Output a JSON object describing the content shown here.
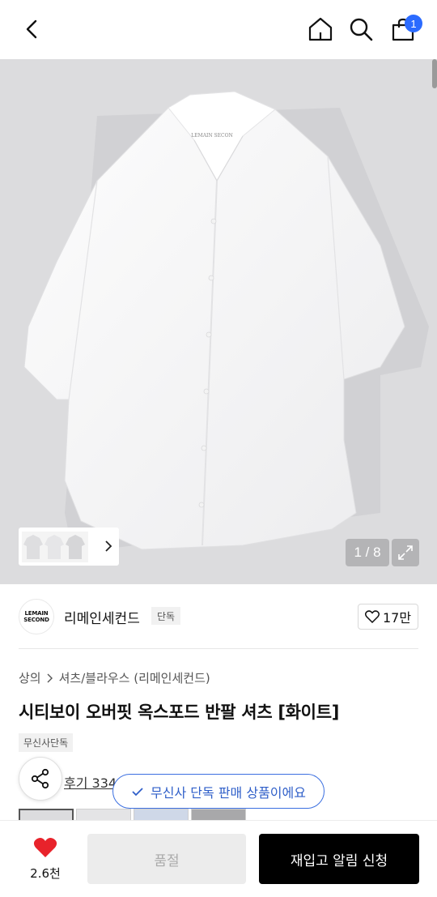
{
  "header": {
    "back_icon": "chevron-left-icon",
    "home_icon": "home-icon",
    "search_icon": "search-icon",
    "bag_icon": "shopping-bag-icon",
    "cart_count": "1",
    "badge_color": "#2b6bff"
  },
  "gallery": {
    "counter": "1 / 8",
    "expand_icon": "expand-icon",
    "product_logo": "LEMAIN SECON"
  },
  "brand": {
    "logo_line1": "LEMAIN",
    "logo_line2": "SECOND",
    "name": "리메인세컨드",
    "tag": "단독",
    "like_count": "17만"
  },
  "product": {
    "breadcrumb": [
      "상의",
      "셔츠/블라우스 (리메인세컨드)"
    ],
    "title": "시티보이 오버핏 옥스포드 반팔 셔츠 [화이트]",
    "exclusive_tag": "무신사단독",
    "reviews": "후기 334",
    "toast": "무신사 단독 판매 상품이에요"
  },
  "bottom_bar": {
    "like_count": "2.6천",
    "heart_color": "#e8232b",
    "soldout_label": "품절",
    "restock_label": "재입고 알림 신청"
  },
  "colors": {
    "accent": "#3b6fe0",
    "primary_button": "#000000"
  }
}
